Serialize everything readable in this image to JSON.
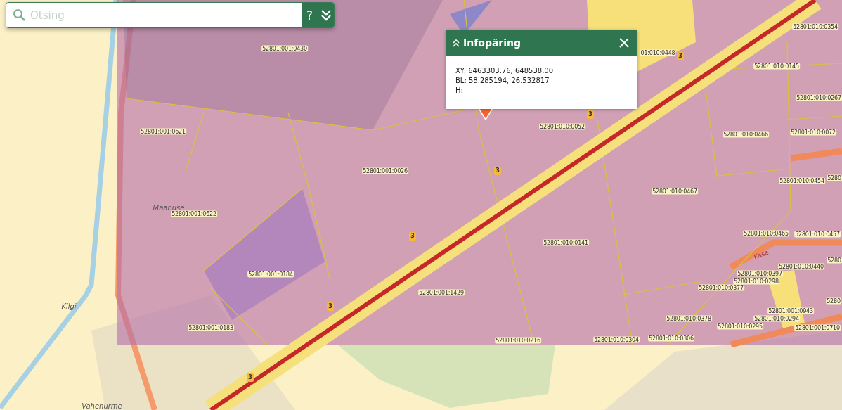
{
  "search": {
    "placeholder": "Otsing",
    "help_button": "?"
  },
  "info_popup": {
    "title": "Infopäring",
    "lines": [
      "XY: 6463303.76, 648538.00",
      "BL: 58.285194, 26.532817",
      "H: -"
    ]
  },
  "map": {
    "labels": [
      {
        "kind": "parcel",
        "text": "52801:010:0354"
      },
      {
        "kind": "parcel",
        "text": "52801:001:0430"
      },
      {
        "kind": "parcel",
        "text": "01:010:0448"
      },
      {
        "kind": "parcel",
        "text": "52801:010:0145"
      },
      {
        "kind": "parcel",
        "text": "52801:010:0267"
      },
      {
        "kind": "parcel",
        "text": "52801:001:0621"
      },
      {
        "kind": "parcel",
        "text": "52801:010:0052"
      },
      {
        "kind": "parcel",
        "text": "52801:010:0466"
      },
      {
        "kind": "parcel",
        "text": "52801:010:0072"
      },
      {
        "kind": "parcel",
        "text": "52801:001:0026"
      },
      {
        "kind": "parcel",
        "text": "52801:010:0454"
      },
      {
        "kind": "parcel",
        "text": "5280"
      },
      {
        "kind": "parcel",
        "text": "52801:010:0467"
      },
      {
        "kind": "place",
        "text": "Maanuse"
      },
      {
        "kind": "parcel",
        "text": "52801:001:0622"
      },
      {
        "kind": "parcel",
        "text": "52801:010:0465"
      },
      {
        "kind": "parcel",
        "text": "52801:010:0457"
      },
      {
        "kind": "parcel",
        "text": "52801:010:0141"
      },
      {
        "kind": "street",
        "text": "Kase"
      },
      {
        "kind": "parcel",
        "text": "52801:010:0440"
      },
      {
        "kind": "parcel",
        "text": "5280"
      },
      {
        "kind": "parcel",
        "text": "52801:001:0184"
      },
      {
        "kind": "parcel",
        "text": "52801:010:0397"
      },
      {
        "kind": "parcel",
        "text": "52801:010:0377"
      },
      {
        "kind": "parcel",
        "text": "52801:010:0298"
      },
      {
        "kind": "parcel",
        "text": "52801:001:1429"
      },
      {
        "kind": "place",
        "text": "Kilgi"
      },
      {
        "kind": "parcel",
        "text": "5280"
      },
      {
        "kind": "parcel",
        "text": "52801:001:0943"
      },
      {
        "kind": "parcel",
        "text": "52801:010:0378"
      },
      {
        "kind": "parcel",
        "text": "52801:010:0294"
      },
      {
        "kind": "parcel",
        "text": "52801:001:0183"
      },
      {
        "kind": "parcel",
        "text": "52801:010:0295"
      },
      {
        "kind": "parcel",
        "text": "52801:001:0710"
      },
      {
        "kind": "parcel",
        "text": "52801:010:0216"
      },
      {
        "kind": "parcel",
        "text": "52801:010:0304"
      },
      {
        "kind": "parcel",
        "text": "52801:010:0306"
      },
      {
        "kind": "place",
        "text": "Vahenurme"
      }
    ],
    "route_markers": [
      "3",
      "3",
      "3",
      "3",
      "3",
      "3"
    ]
  }
}
